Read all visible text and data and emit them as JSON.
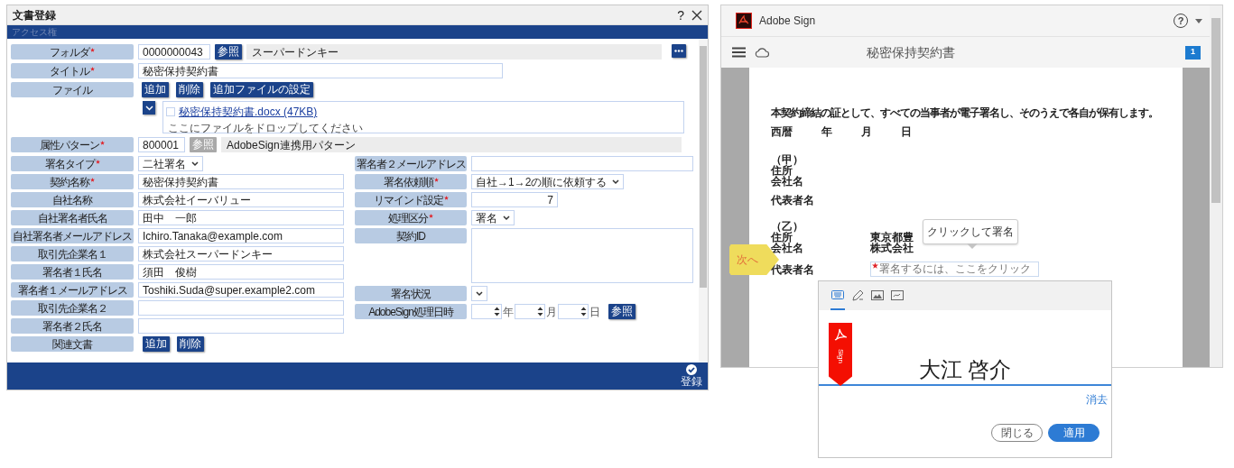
{
  "dialog": {
    "title": "文書登録",
    "help": "?",
    "section_tab": "アクセス権",
    "top_rows": [
      {
        "kind": "lookup",
        "label": "フォルダ",
        "required": true,
        "code": "0000000043",
        "button": "参照",
        "button_disabled": false,
        "value": "スーパードンキー",
        "more": true
      },
      {
        "kind": "text",
        "label": "タイトル",
        "required": true,
        "value": "秘密保持契約書"
      },
      {
        "kind": "file",
        "label": "ファイル",
        "required": false,
        "buttons": [
          "追加",
          "削除",
          "追加ファイルの設定"
        ],
        "files": [
          {
            "name": "秘密保持契約書.docx (47KB)",
            "checked": false
          }
        ],
        "drop_hint": "ここにファイルをドロップしてください"
      },
      {
        "kind": "lookup",
        "label": "属性パターン",
        "required": true,
        "code": "800001",
        "button": "参照",
        "button_disabled": true,
        "value": "AdobeSign連携用パターン",
        "more": false
      }
    ],
    "left_fields": [
      {
        "kind": "select",
        "label": "署名タイプ",
        "required": true,
        "value": "二社署名"
      },
      {
        "kind": "text",
        "label": "契約名称",
        "required": true,
        "value": "秘密保持契約書"
      },
      {
        "kind": "text",
        "label": "自社名称",
        "required": false,
        "value": "株式会社イーバリュー"
      },
      {
        "kind": "text",
        "label": "自社署名者氏名",
        "required": false,
        "value": "田中　一郎"
      },
      {
        "kind": "text",
        "label": "自社署名者メールアドレス",
        "required": false,
        "value": "Ichiro.Tanaka@example.com"
      },
      {
        "kind": "text",
        "label": "取引先企業名１",
        "required": false,
        "value": "株式会社スーパードンキー"
      },
      {
        "kind": "text",
        "label": "署名者１氏名",
        "required": false,
        "value": "須田　俊樹"
      },
      {
        "kind": "text",
        "label": "署名者１メールアドレス",
        "required": false,
        "value": "Toshiki.Suda@super.example2.com"
      },
      {
        "kind": "text",
        "label": "取引先企業名２",
        "required": false
      },
      {
        "kind": "text",
        "label": "署名者２氏名",
        "required": false
      },
      {
        "kind": "buttons",
        "label": "関連文書",
        "required": false,
        "buttons": [
          "追加",
          "削除"
        ]
      }
    ],
    "right_fields": [
      {
        "kind": "text",
        "label": "署名者２メールアドレス",
        "required": false
      },
      {
        "kind": "select",
        "label": "署名依頼順",
        "required": true,
        "value": "自社→1→2の順に依頼する"
      },
      {
        "kind": "number",
        "label": "リマインド設定",
        "required": true,
        "value": "7"
      },
      {
        "kind": "select",
        "label": "処理区分",
        "required": true,
        "value": "署名"
      },
      {
        "kind": "textarea",
        "label": "契約ID",
        "required": false
      },
      {
        "kind": "select",
        "label": "署名状況",
        "required": false
      },
      {
        "kind": "date",
        "label": "AdobeSign処理日時",
        "required": false,
        "units": [
          "年",
          "月",
          "日"
        ],
        "button": "参照"
      }
    ],
    "submit": "登録"
  },
  "sign_app": {
    "app_name": "Adobe Sign",
    "help": "?",
    "doc_title": "秘密保持契約書",
    "page_badge": "1",
    "document": {
      "statement": "本契約締結の証として、すべての当事者が電子署名し、そのうえで各自が保有します。",
      "date_labels": [
        "西暦",
        "年",
        "月",
        "日"
      ],
      "parties": [
        {
          "heading": "（甲）",
          "rows": [
            {
              "label": "住所"
            },
            {
              "label": "会社名"
            }
          ],
          "rep_label": "代表者名"
        },
        {
          "heading": "（乙）",
          "rows": [
            {
              "label": "住所",
              "value": "東京都豊"
            },
            {
              "label": "会社名",
              "value": "株式会社"
            }
          ],
          "rep_label": "代表者名",
          "signature_field": {
            "placeholder": "署名するには、ここをクリック",
            "required": true
          }
        }
      ]
    },
    "tooltip": "クリックして署名",
    "next_tag": "次へ",
    "signature_panel": {
      "tabs": [
        {
          "kind": "type",
          "selected": true
        },
        {
          "kind": "draw",
          "selected": false
        },
        {
          "kind": "image",
          "selected": false
        },
        {
          "kind": "mobile",
          "selected": false
        }
      ],
      "badge": "Sign",
      "signature": "大江 啓介",
      "clear": "消去",
      "buttons": [
        {
          "label": "閉じる",
          "primary": false
        },
        {
          "label": "適用",
          "primary": true
        }
      ]
    }
  }
}
